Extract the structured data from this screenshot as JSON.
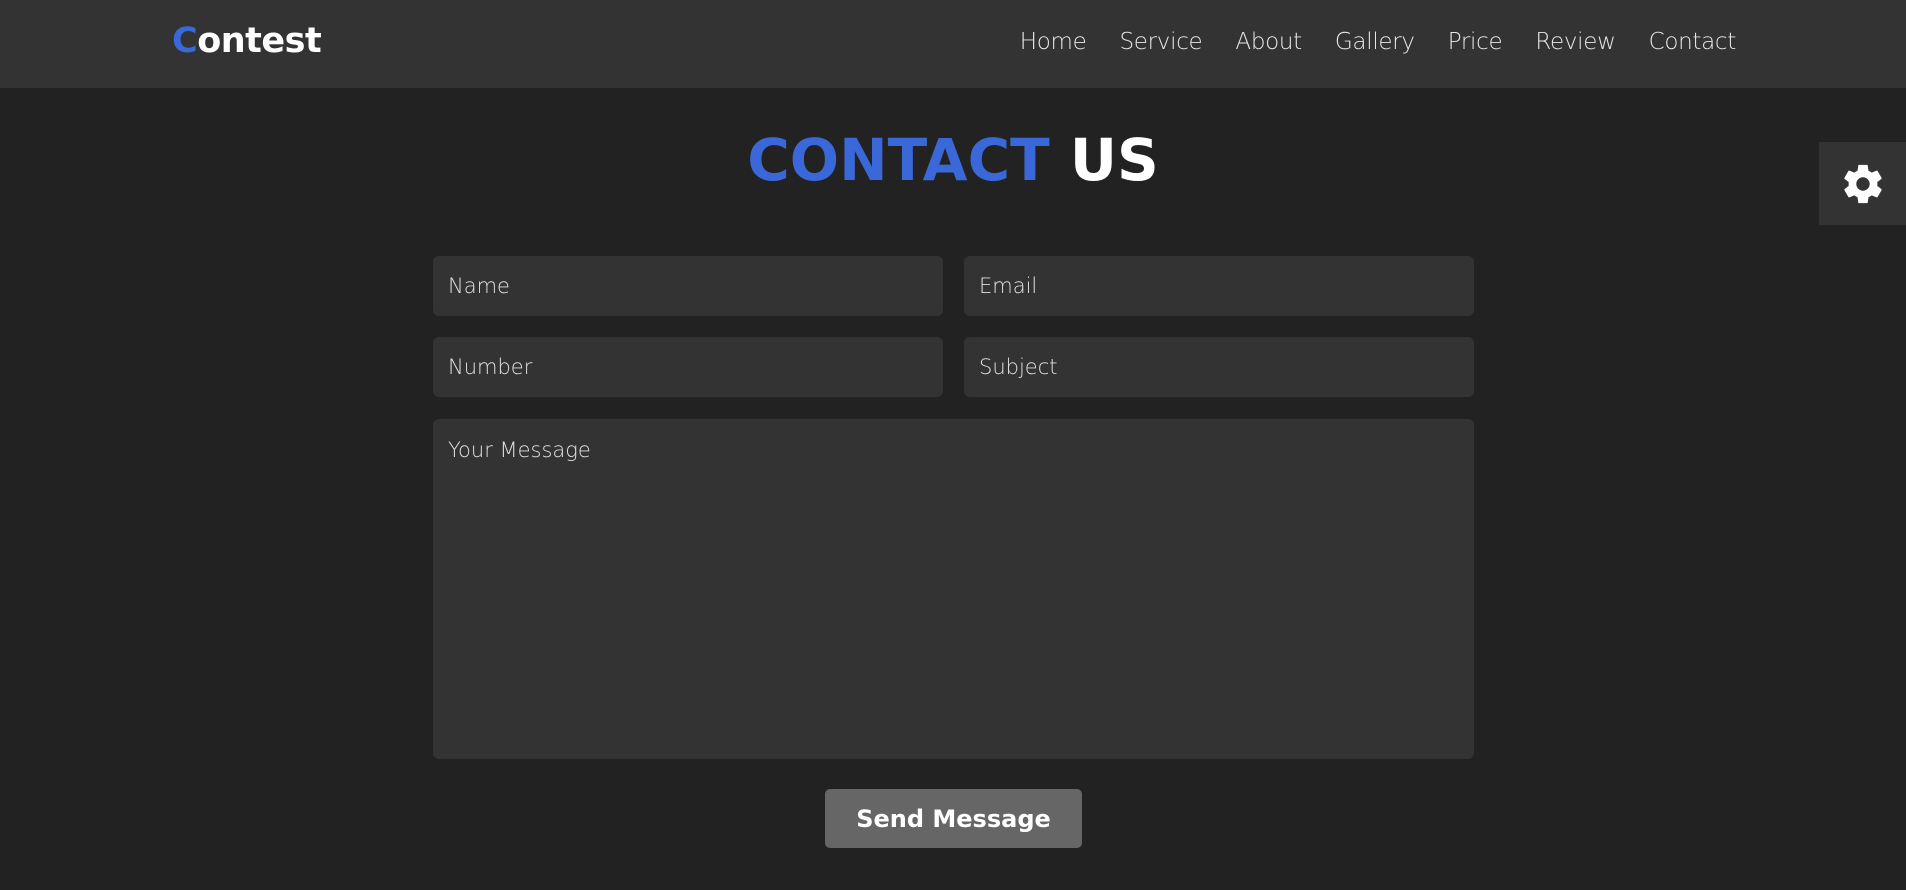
{
  "navbar": {
    "logo_first": "C",
    "logo_rest": "ontest",
    "links": [
      "Home",
      "Service",
      "About",
      "Gallery",
      "Price",
      "Review",
      "Contact"
    ]
  },
  "heading": {
    "accent": "CONTACT",
    "rest": "US"
  },
  "settings": {
    "icon": "gear-icon"
  },
  "form": {
    "name_placeholder": "Name",
    "email_placeholder": "Email",
    "number_placeholder": "Number",
    "subject_placeholder": "Subject",
    "message_placeholder": "Your Message",
    "send_label": "Send Message"
  },
  "colors": {
    "accent": "#3a68d8",
    "background": "#222222",
    "panel": "#333333",
    "button": "#666666"
  }
}
